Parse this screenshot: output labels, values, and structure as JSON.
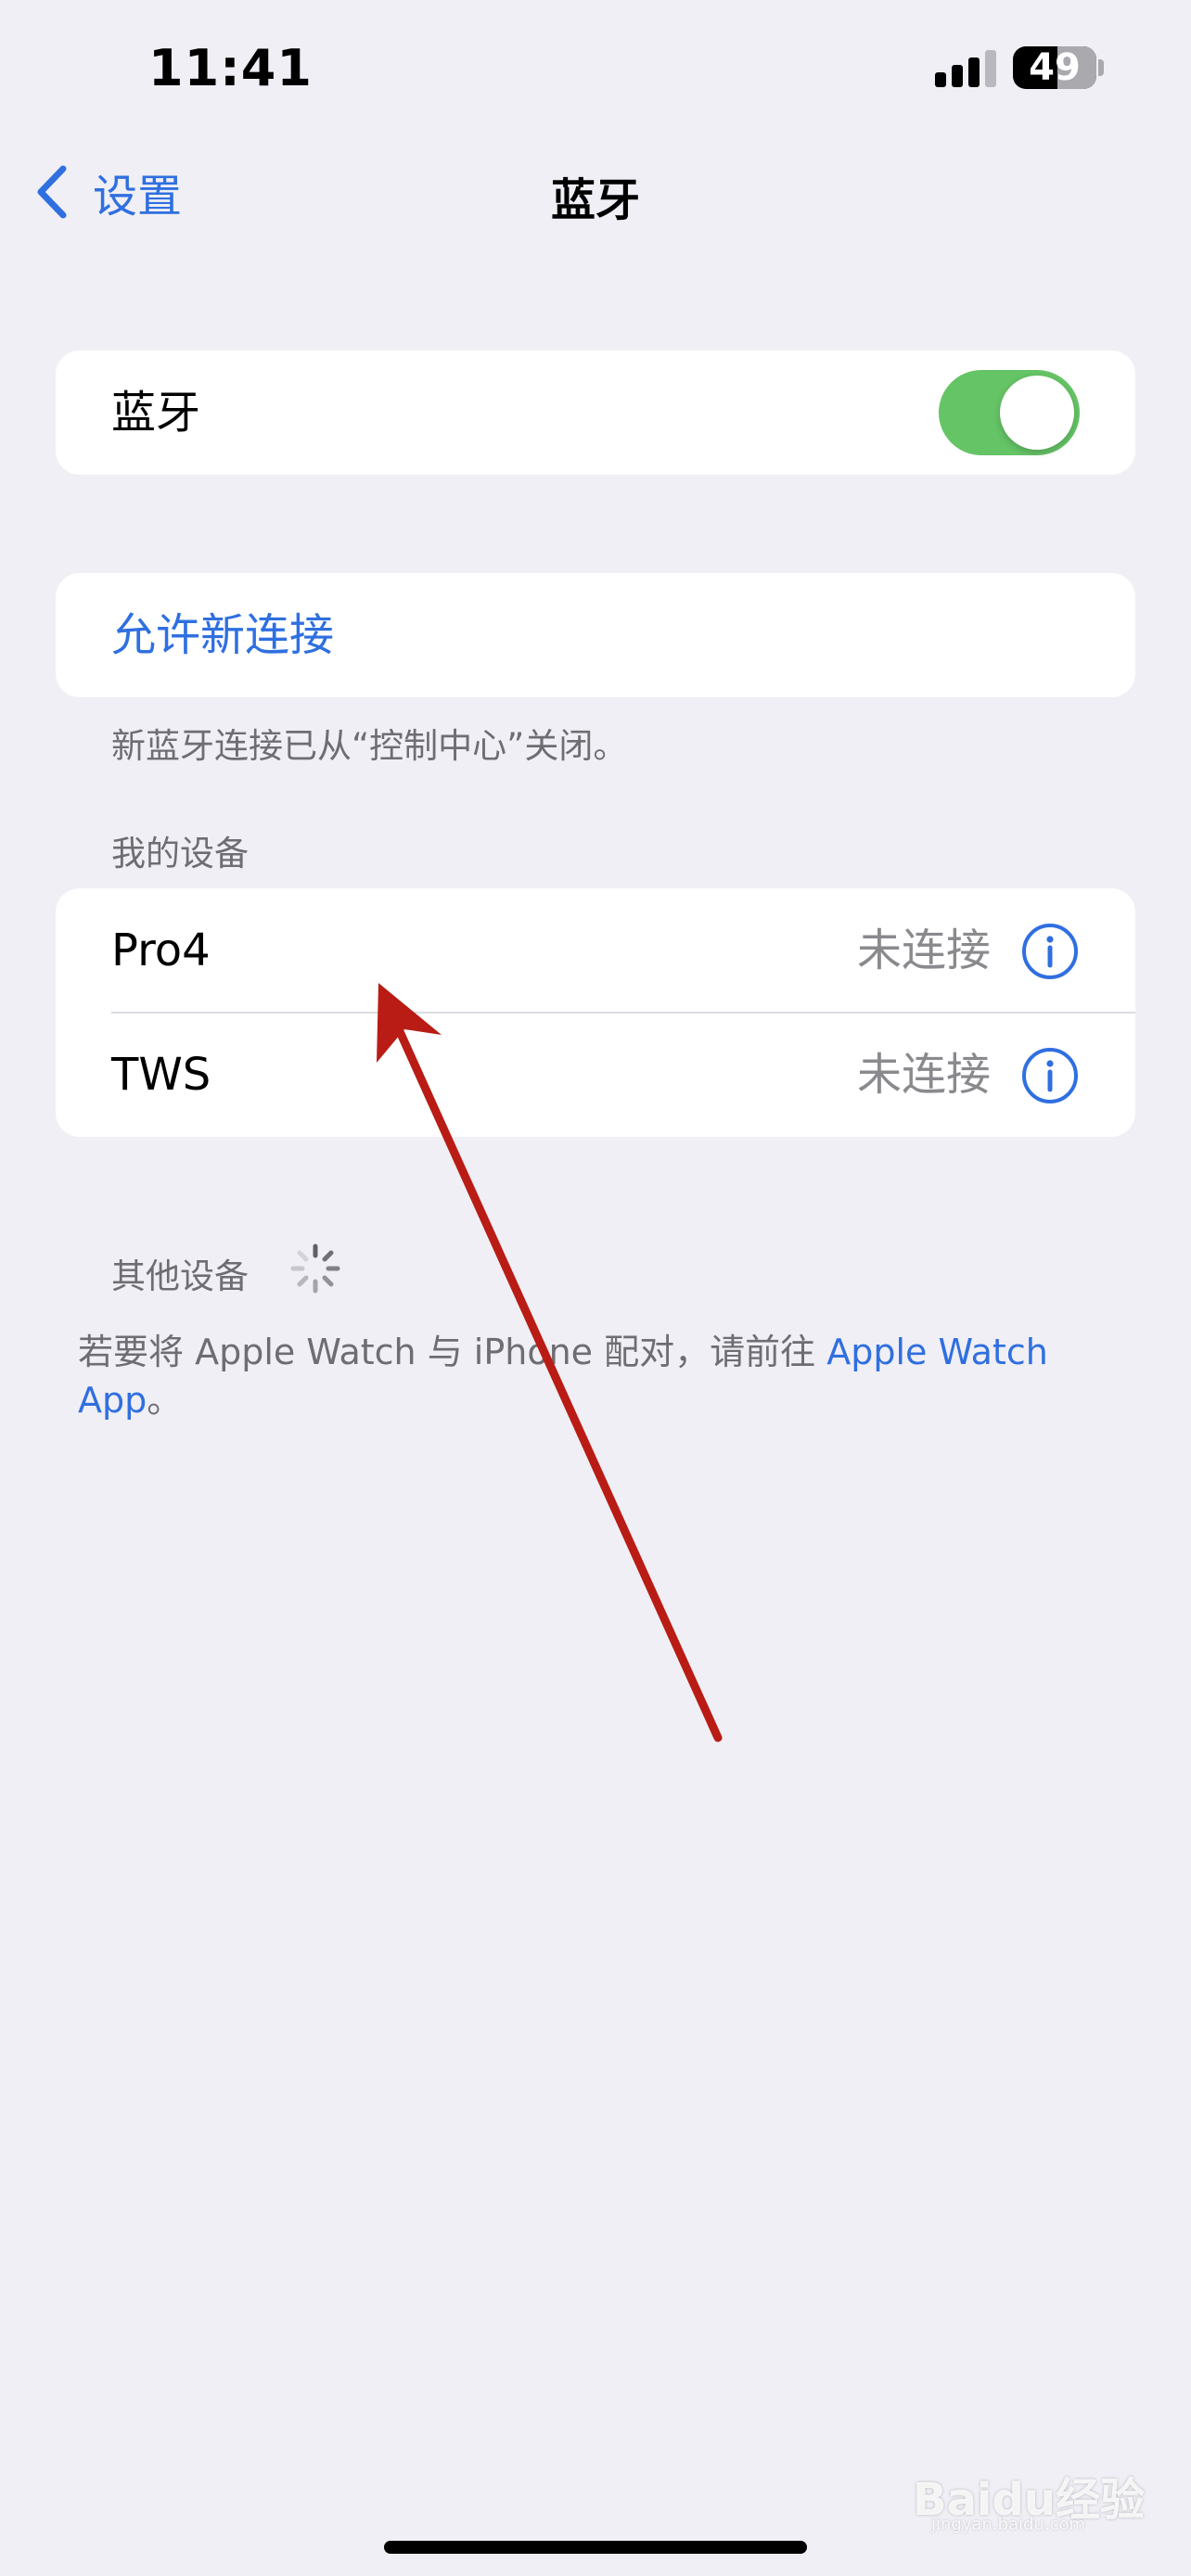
{
  "status_bar": {
    "time": "11:41",
    "battery_percent": "49",
    "signal_bars_active": 3,
    "signal_bars_total": 4
  },
  "nav": {
    "back_label": "设置",
    "title": "蓝牙"
  },
  "bluetooth": {
    "label": "蓝牙",
    "enabled": true,
    "toggle_color": "#65c466"
  },
  "allow_new": {
    "label": "允许新连接",
    "note": "新蓝牙连接已从“控制中心”关闭。"
  },
  "my_devices": {
    "header": "我的设备",
    "items": [
      {
        "name": "Pro4",
        "status": "未连接",
        "icon": "info-icon"
      },
      {
        "name": "TWS",
        "status": "未连接",
        "icon": "info-icon"
      }
    ]
  },
  "other_devices": {
    "header": "其他设备",
    "icon": "loading-spinner-icon"
  },
  "watch_note": {
    "text": "若要将 Apple Watch 与 iPhone 配对，请前往 ",
    "link": "Apple Watch App",
    "suffix": "。"
  },
  "annotation": {
    "icon": "red-arrow-icon",
    "color": "#b91c14"
  },
  "watermark": {
    "text": "Baidu经验",
    "sub": "jingyan.baidu.com"
  },
  "colors": {
    "accent": "#2f6fe0",
    "background": "#f0eff5"
  }
}
